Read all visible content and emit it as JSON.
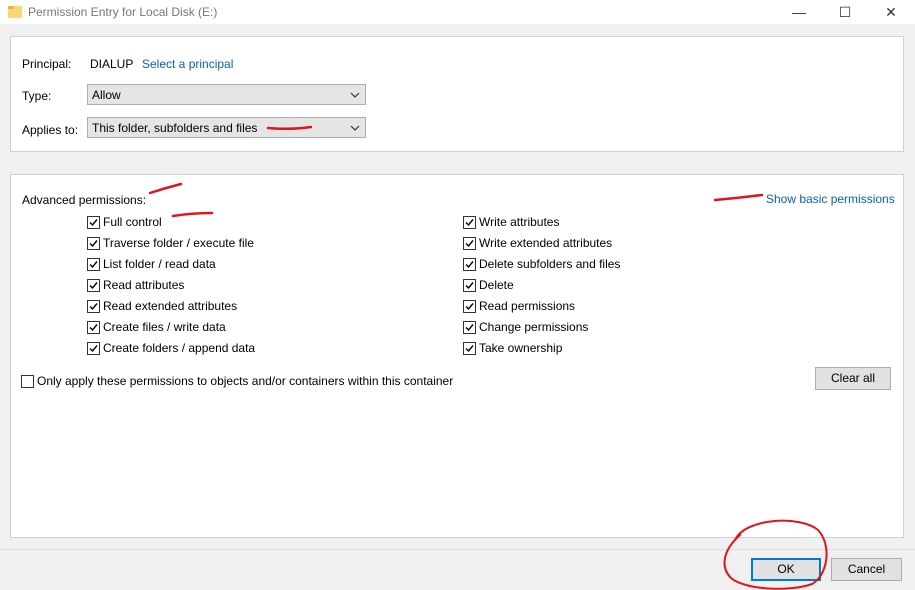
{
  "window": {
    "title": "Permission Entry for Local Disk  (E:)",
    "minimize_glyph": "—",
    "maximize_glyph": "☐",
    "close_glyph": "✕"
  },
  "principal": {
    "label": "Principal:",
    "value": "DIALUP",
    "link": "Select a principal"
  },
  "type": {
    "label": "Type:",
    "value": "Allow"
  },
  "applies_to": {
    "label": "Applies to:",
    "value": "This folder, subfolders and files"
  },
  "advanced": {
    "label": "Advanced permissions:",
    "show_basic_link": "Show basic permissions",
    "left": [
      {
        "label": "Full control",
        "checked": true
      },
      {
        "label": "Traverse folder / execute file",
        "checked": true
      },
      {
        "label": "List folder / read data",
        "checked": true
      },
      {
        "label": "Read attributes",
        "checked": true
      },
      {
        "label": "Read extended attributes",
        "checked": true
      },
      {
        "label": "Create files / write data",
        "checked": true
      },
      {
        "label": "Create folders / append data",
        "checked": true
      }
    ],
    "right": [
      {
        "label": "Write attributes",
        "checked": true
      },
      {
        "label": "Write extended attributes",
        "checked": true
      },
      {
        "label": "Delete subfolders and files",
        "checked": true
      },
      {
        "label": "Delete",
        "checked": true
      },
      {
        "label": "Read permissions",
        "checked": true
      },
      {
        "label": "Change permissions",
        "checked": true
      },
      {
        "label": "Take ownership",
        "checked": true
      }
    ],
    "only_apply": {
      "label": "Only apply these permissions to objects and/or containers within this container",
      "checked": false
    },
    "clear_all": "Clear all"
  },
  "footer": {
    "ok": "OK",
    "cancel": "Cancel"
  },
  "colors": {
    "link": "#0b62a8",
    "annotation": "#e0141c",
    "default_button_border": "#0078d7"
  }
}
